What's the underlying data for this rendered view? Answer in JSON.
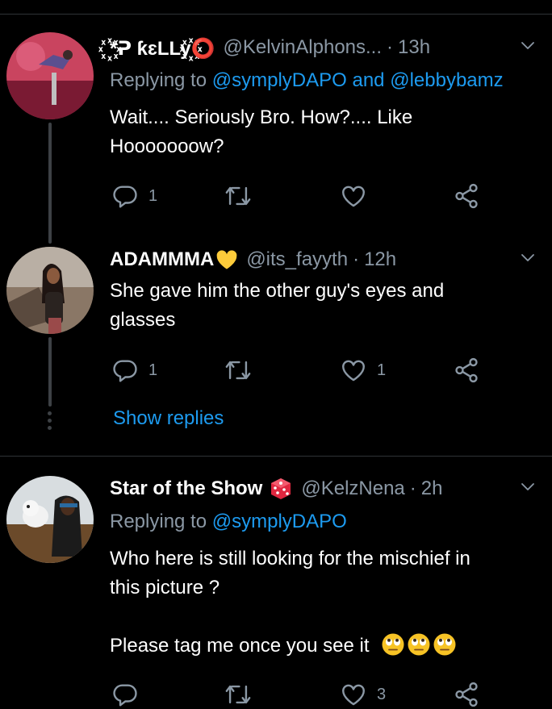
{
  "tweets": [
    {
      "name": "꙰*ᕈ ƙɛLLy꙰⭕",
      "handle": "@KelvinAlphons...",
      "time": "13h",
      "replying_prefix": "Replying to",
      "replying_mention_1": "@symplyDAPO",
      "replying_and": "and",
      "replying_mention_2": "@lebbybamz",
      "text_line_1": "Wait.... Seriously Bro. How?.... Like",
      "text_line_2": "Hooooooow?",
      "reply_count": "1",
      "retweet_count": "",
      "like_count": ""
    },
    {
      "name": "ADAMMMA",
      "name_emoji": "yellow-heart",
      "handle": "@its_fayyth",
      "time": "12h",
      "text_line_1": "She gave him the other guy's eyes and",
      "text_line_2": "glasses",
      "reply_count": "1",
      "retweet_count": "",
      "like_count": "1"
    },
    {
      "name": "Star of the Show",
      "name_emoji": "game-die",
      "handle": "@KelzNena",
      "time": "2h",
      "replying_prefix": "Replying to",
      "replying_mention_1": "@symplyDAPO",
      "text_line_1": "Who here is still looking for the mischief in",
      "text_line_2": "this picture ?",
      "text_line_3": "Please tag me once you see it",
      "text_emojis": [
        "face-with-rolling-eyes",
        "face-with-rolling-eyes",
        "face-with-rolling-eyes"
      ],
      "reply_count": "",
      "retweet_count": "",
      "like_count": "3"
    }
  ],
  "show_replies_label": "Show replies",
  "colors": {
    "background": "#000000",
    "secondary_text": "#8b98a5",
    "link": "#1d9bf0",
    "divider": "#2f3336",
    "thread_line": "#3d4145"
  }
}
